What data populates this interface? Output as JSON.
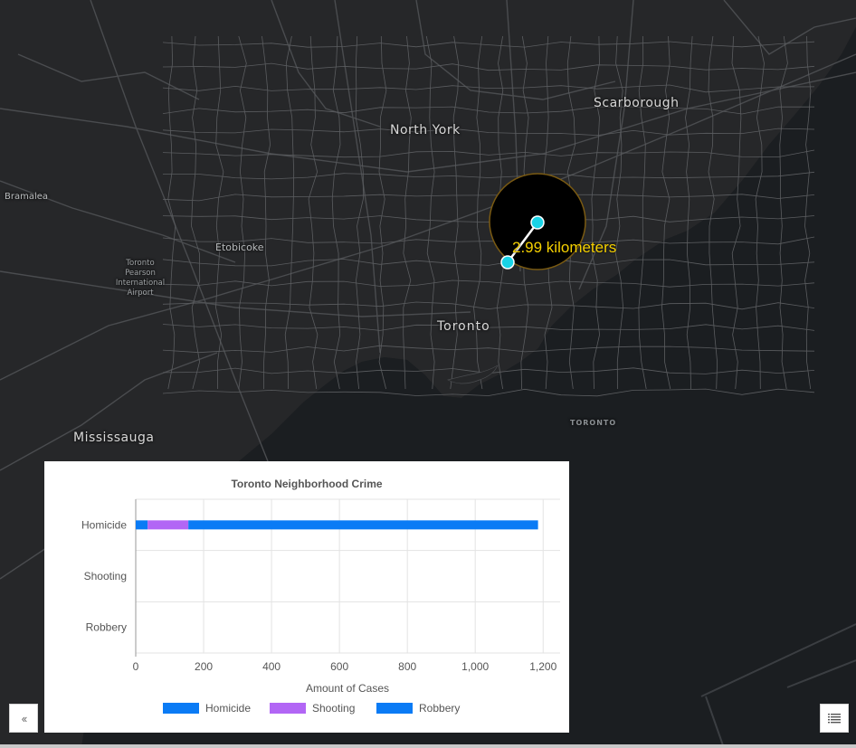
{
  "map": {
    "labels": {
      "north_york": "North York",
      "scarborough": "Scarborough",
      "bramalea": "Bramalea",
      "etobicoke": "Etobicoke",
      "airport_line1": "Toronto",
      "airport_line2": "Pearson",
      "airport_line3": "International",
      "airport_line4": "Airport",
      "toronto": "Toronto",
      "toronto_water": "TORONTO",
      "mississauga": "Mississauga"
    },
    "measurement": {
      "label": "2.99 kilometers",
      "color": "#f5d000",
      "endpoint_color": "#19d3e6"
    },
    "colors": {
      "land": "#262729",
      "water": "#1b1e21",
      "roads": "#4a4c4f",
      "boundaries": "#5c5e61"
    }
  },
  "chart_panel": {
    "chart_data": {
      "type": "bar",
      "orientation": "horizontal",
      "stacked": true,
      "title": "Toronto Neighborhood Crime",
      "xlabel": "Amount of Cases",
      "ylabel": "",
      "categories": [
        "Homicide",
        "Shooting",
        "Robbery"
      ],
      "series": [
        {
          "name": "Homicide",
          "color": "#0a7bf5",
          "values": [
            35,
            0,
            0
          ]
        },
        {
          "name": "Shooting",
          "color": "#b266f5",
          "values": [
            120,
            0,
            0
          ]
        },
        {
          "name": "Robbery",
          "color": "#0a7bf5",
          "values": [
            1030,
            0,
            0
          ]
        }
      ],
      "xlim": [
        0,
        1250
      ],
      "xticks": [
        0,
        200,
        400,
        600,
        800,
        1000,
        1200
      ],
      "xtick_labels": [
        "0",
        "200",
        "400",
        "600",
        "800",
        "1,000",
        "1,200"
      ],
      "grid": true,
      "legend_position": "bottom"
    }
  },
  "controls": {
    "collapse_icon": "double-chevron-left-icon",
    "collapse_glyph": "‹‹",
    "list_icon": "list-icon"
  }
}
